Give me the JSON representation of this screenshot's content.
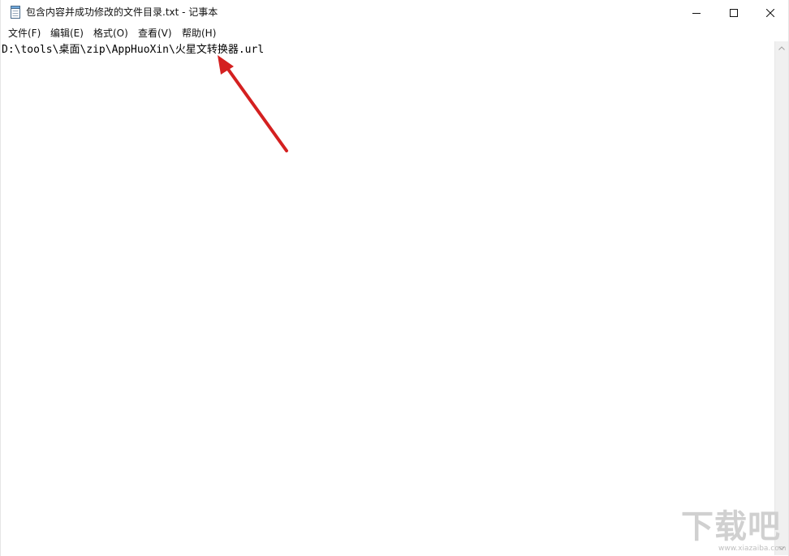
{
  "window": {
    "title": "包含内容并成功修改的文件目录.txt - 记事本",
    "app_icon": "notepad-icon",
    "controls": {
      "minimize_icon": "minimize-icon",
      "maximize_icon": "maximize-icon",
      "close_icon": "close-icon"
    }
  },
  "menubar": {
    "items": [
      {
        "label": "文件(F)"
      },
      {
        "label": "编辑(E)"
      },
      {
        "label": "格式(O)"
      },
      {
        "label": "查看(V)"
      },
      {
        "label": "帮助(H)"
      }
    ]
  },
  "editor": {
    "content": "D:\\tools\\桌面\\zip\\AppHuoXin\\火星文转换器.url"
  },
  "annotation": {
    "type": "arrow",
    "color": "#d42020"
  },
  "watermark": {
    "logo_text": "下载吧",
    "url": "www.xiazaiba.com"
  }
}
